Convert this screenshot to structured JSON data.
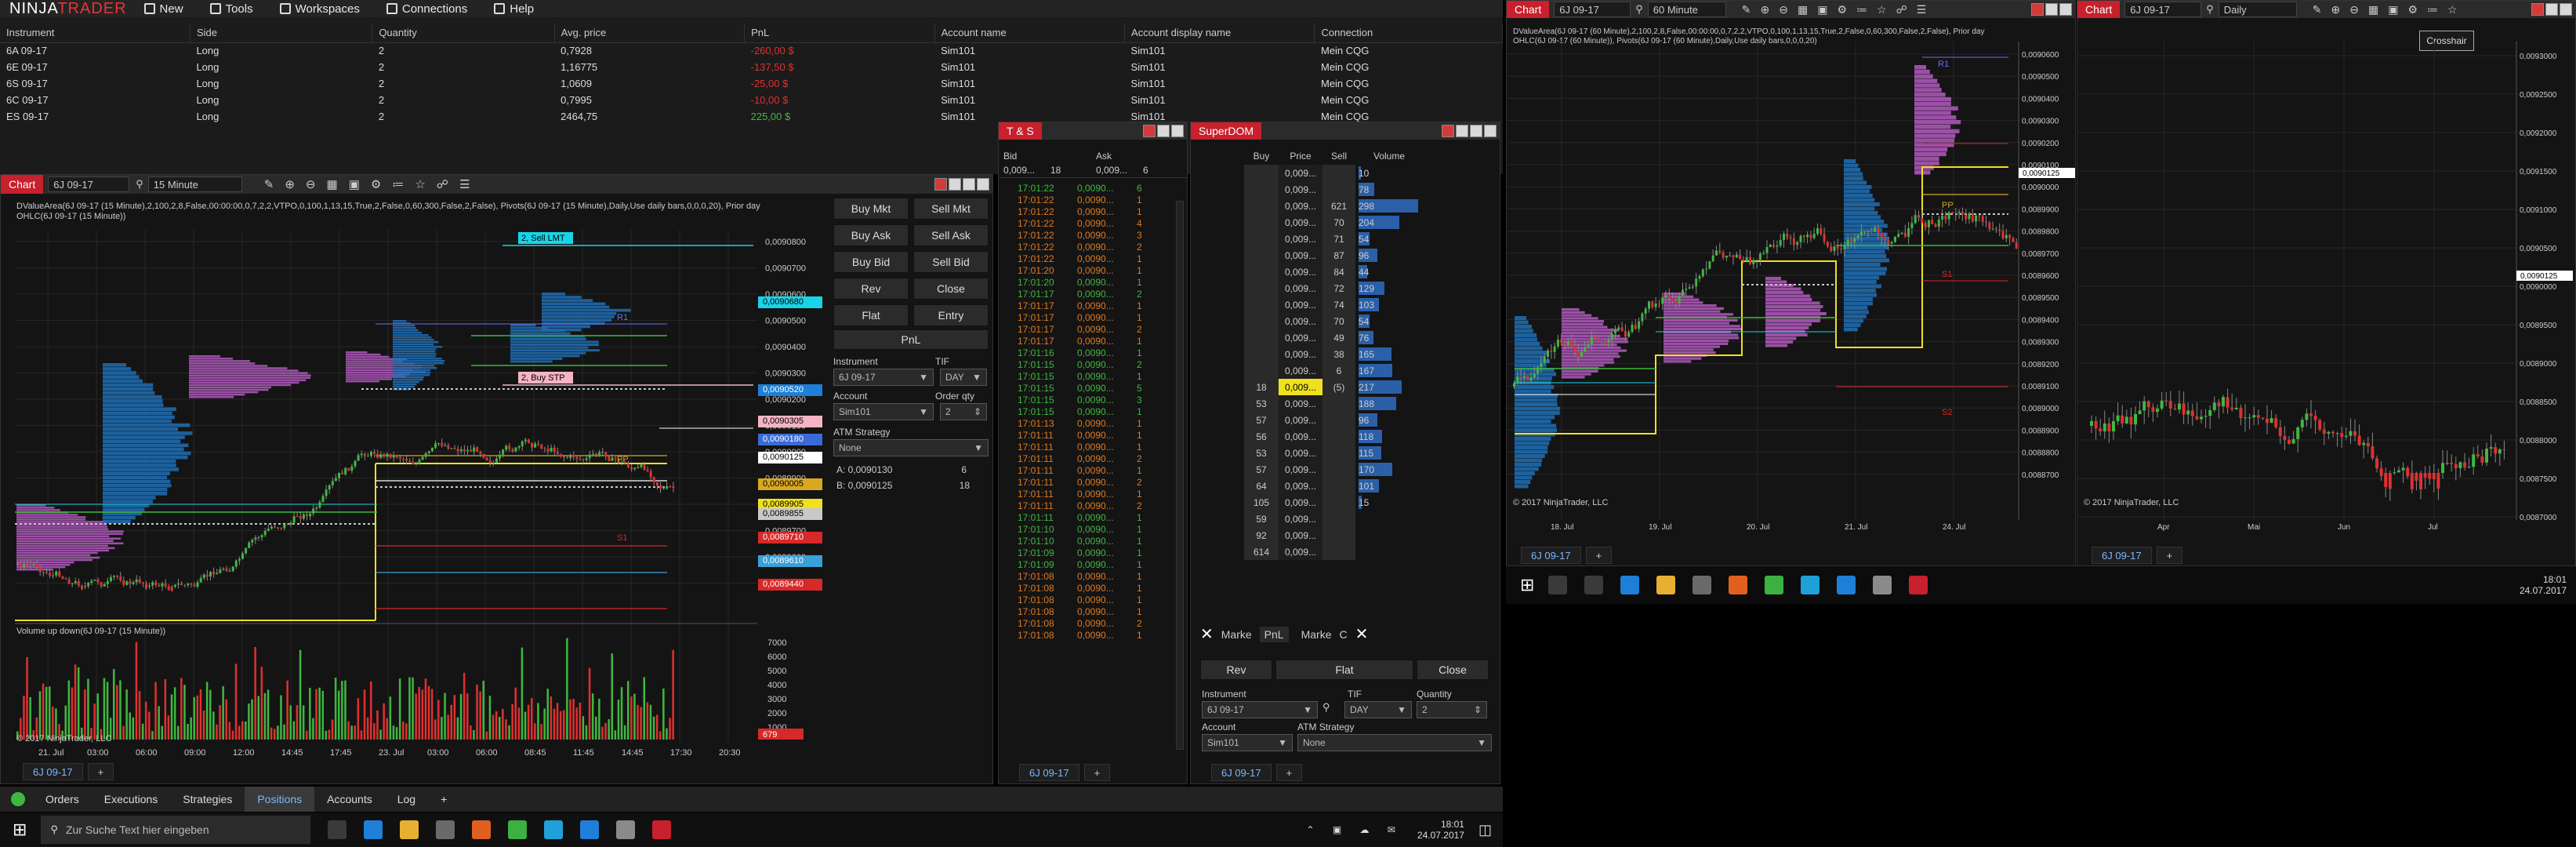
{
  "control_center": {
    "logo_left": "NINJA",
    "logo_right": "TRADER",
    "menu": [
      {
        "label": "New",
        "icon": "file-icon"
      },
      {
        "label": "Tools",
        "icon": "wrench-icon"
      },
      {
        "label": "Workspaces",
        "icon": "monitor-icon"
      },
      {
        "label": "Connections",
        "icon": "plug-icon"
      },
      {
        "label": "Help",
        "icon": "question-icon"
      }
    ],
    "positions": {
      "headers": [
        "Instrument",
        "Side",
        "Quantity",
        "Avg. price",
        "PnL",
        "Account name",
        "Account display name",
        "Connection"
      ],
      "rows": [
        {
          "instrument": "6A 09-17",
          "side": "Long",
          "qty": "2",
          "avg": "0,7928",
          "pnl": "-260,00 $",
          "pnl_sign": "neg",
          "account": "Sim101",
          "display": "Sim101",
          "conn": "Mein CQG"
        },
        {
          "instrument": "6E 09-17",
          "side": "Long",
          "qty": "2",
          "avg": "1,16775",
          "pnl": "-137,50 $",
          "pnl_sign": "neg",
          "account": "Sim101",
          "display": "Sim101",
          "conn": "Mein CQG"
        },
        {
          "instrument": "6S 09-17",
          "side": "Long",
          "qty": "2",
          "avg": "1,0609",
          "pnl": "-25,00 $",
          "pnl_sign": "neg",
          "account": "Sim101",
          "display": "Sim101",
          "conn": "Mein CQG"
        },
        {
          "instrument": "6C 09-17",
          "side": "Long",
          "qty": "2",
          "avg": "0,7995",
          "pnl": "-10,00 $",
          "pnl_sign": "neg",
          "account": "Sim101",
          "display": "Sim101",
          "conn": "Mein CQG"
        },
        {
          "instrument": "ES 09-17",
          "side": "Long",
          "qty": "2",
          "avg": "2464,75",
          "pnl": "225,00 $",
          "pnl_sign": "pos",
          "account": "Sim101",
          "display": "Sim101",
          "conn": "Mein CQG"
        }
      ]
    },
    "bottom_tabs": [
      "Orders",
      "Executions",
      "Strategies",
      "Positions",
      "Accounts",
      "Log"
    ],
    "active_tab": "Positions"
  },
  "chart1": {
    "title": "Chart",
    "instrument": "6J 09-17",
    "interval": "15 Minute",
    "indicator_line1": "DValueArea(6J 09-17 (15 Minute),2,100,2,8,False,00:00:00,0,7,2,2,VTPO,0,100,1,13,15,True,2,False,0,60,300,False,2,False), Pivots(6J 09-17 (15 Minute),Daily,Use daily bars,0,0,0,20), Prior day",
    "indicator_line2": "OHLC(6J 09-17 (15 Minute))",
    "sell_lmt": "2, Sell LMT",
    "buy_stp": "2, Buy STP",
    "pp_label": "PP",
    "s1_label": "S1",
    "r1_label": "R1",
    "volume_label": "Volume up down(6J 09-17 (15 Minute))",
    "copyright": "© 2017 NinjaTrader, LLC",
    "price_ticks": [
      "0,0090800",
      "0,0090700",
      "0,0090600",
      "0,0090500",
      "0,0090400",
      "0,0090300",
      "0,0090200",
      "0,0090100",
      "0,0090000",
      "0,0089900",
      "0,0089800",
      "0,0089700",
      "0,0089600",
      "0,0089500"
    ],
    "price_tags": [
      {
        "label": "0,0090680",
        "color": "#19d4e8",
        "text": "#000"
      },
      {
        "label": "0,0090520",
        "color": "#1e7fd8",
        "text": "#fff"
      },
      {
        "label": "0,0090305",
        "color": "#f4b4c4",
        "text": "#000"
      },
      {
        "label": "0,0090180",
        "color": "#3a6ad8",
        "text": "#fff"
      },
      {
        "label": "0,0090125",
        "color": "#ffffff",
        "text": "#000"
      },
      {
        "label": "0,0090005",
        "color": "#d8a820",
        "text": "#000"
      },
      {
        "label": "0,0089905",
        "color": "#f0e020",
        "text": "#000"
      },
      {
        "label": "0,0089855",
        "color": "#c8c8c8",
        "text": "#000"
      },
      {
        "label": "0,0089710",
        "color": "#d82828",
        "text": "#fff"
      },
      {
        "label": "0,0089610",
        "color": "#3aa0d8",
        "text": "#fff"
      },
      {
        "label": "0,0089440",
        "color": "#d82828",
        "text": "#fff"
      }
    ],
    "time_ticks": [
      "21. Jul",
      "03:00",
      "06:00",
      "09:00",
      "12:00",
      "14:45",
      "17:45",
      "23. Jul",
      "03:00",
      "06:00",
      "08:45",
      "11:45",
      "14:45",
      "17:30",
      "20:30"
    ],
    "volume_ticks": [
      "7000",
      "6000",
      "5000",
      "4000",
      "3000",
      "2000",
      "1000"
    ],
    "volume_tag": "679",
    "tab": "6J 09-17"
  },
  "chart_trader": {
    "buttons": [
      "Buy Mkt",
      "Sell Mkt",
      "Buy Ask",
      "Sell Ask",
      "Buy Bid",
      "Sell Bid",
      "Rev",
      "Close",
      "Flat",
      "Entry"
    ],
    "pnl": "PnL",
    "instrument_label": "Instrument",
    "instrument_value": "6J 09-17",
    "tif_label": "TIF",
    "tif_value": "DAY",
    "account_label": "Account",
    "account_value": "Sim101",
    "order_qty_label": "Order qty",
    "order_qty_value": "2",
    "atm_label": "ATM Strategy",
    "atm_value": "None",
    "ask_line": "A:  0,0090130",
    "ask_qty": "6",
    "bid_line": "B:  0,0090125",
    "bid_qty": "18"
  },
  "ts": {
    "title": "T & S",
    "bid_header": "Bid",
    "ask_header": "Ask",
    "bid_value": "0,009...",
    "bid_size": "18",
    "ask_value": "0,009...",
    "ask_size": "6",
    "rows": [
      {
        "t": "17:01:22",
        "p": "0,0090...",
        "s": "6",
        "c": "g"
      },
      {
        "t": "17:01:22",
        "p": "0,0090...",
        "s": "1",
        "c": "o"
      },
      {
        "t": "17:01:22",
        "p": "0,0090...",
        "s": "1",
        "c": "o"
      },
      {
        "t": "17:01:22",
        "p": "0,0090...",
        "s": "4",
        "c": "o"
      },
      {
        "t": "17:01:22",
        "p": "0,0090...",
        "s": "3",
        "c": "o"
      },
      {
        "t": "17:01:22",
        "p": "0,0090...",
        "s": "2",
        "c": "o"
      },
      {
        "t": "17:01:22",
        "p": "0,0090...",
        "s": "1",
        "c": "o"
      },
      {
        "t": "17:01:20",
        "p": "0,0090...",
        "s": "1",
        "c": "o"
      },
      {
        "t": "17:01:20",
        "p": "0,0090...",
        "s": "1",
        "c": "g"
      },
      {
        "t": "17:01:17",
        "p": "0,0090...",
        "s": "2",
        "c": "g"
      },
      {
        "t": "17:01:17",
        "p": "0,0090...",
        "s": "1",
        "c": "o"
      },
      {
        "t": "17:01:17",
        "p": "0,0090...",
        "s": "1",
        "c": "o"
      },
      {
        "t": "17:01:17",
        "p": "0,0090...",
        "s": "2",
        "c": "o"
      },
      {
        "t": "17:01:17",
        "p": "0,0090...",
        "s": "1",
        "c": "o"
      },
      {
        "t": "17:01:16",
        "p": "0,0090...",
        "s": "1",
        "c": "g"
      },
      {
        "t": "17:01:15",
        "p": "0,0090...",
        "s": "2",
        "c": "g"
      },
      {
        "t": "17:01:15",
        "p": "0,0090...",
        "s": "1",
        "c": "g"
      },
      {
        "t": "17:01:15",
        "p": "0,0090...",
        "s": "5",
        "c": "g"
      },
      {
        "t": "17:01:15",
        "p": "0,0090...",
        "s": "3",
        "c": "g"
      },
      {
        "t": "17:01:15",
        "p": "0,0090...",
        "s": "1",
        "c": "g"
      },
      {
        "t": "17:01:13",
        "p": "0,0090...",
        "s": "1",
        "c": "o"
      },
      {
        "t": "17:01:11",
        "p": "0,0090...",
        "s": "1",
        "c": "o"
      },
      {
        "t": "17:01:11",
        "p": "0,0090...",
        "s": "1",
        "c": "o"
      },
      {
        "t": "17:01:11",
        "p": "0,0090...",
        "s": "2",
        "c": "o"
      },
      {
        "t": "17:01:11",
        "p": "0,0090...",
        "s": "1",
        "c": "o"
      },
      {
        "t": "17:01:11",
        "p": "0,0090...",
        "s": "2",
        "c": "o"
      },
      {
        "t": "17:01:11",
        "p": "0,0090...",
        "s": "1",
        "c": "o"
      },
      {
        "t": "17:01:11",
        "p": "0,0090...",
        "s": "2",
        "c": "o"
      },
      {
        "t": "17:01:11",
        "p": "0,0090...",
        "s": "1",
        "c": "g"
      },
      {
        "t": "17:01:10",
        "p": "0,0090...",
        "s": "1",
        "c": "g"
      },
      {
        "t": "17:01:10",
        "p": "0,0090...",
        "s": "1",
        "c": "g"
      },
      {
        "t": "17:01:09",
        "p": "0,0090...",
        "s": "1",
        "c": "g"
      },
      {
        "t": "17:01:09",
        "p": "0,0090...",
        "s": "1",
        "c": "g"
      },
      {
        "t": "17:01:08",
        "p": "0,0090...",
        "s": "1",
        "c": "o"
      },
      {
        "t": "17:01:08",
        "p": "0,0090...",
        "s": "1",
        "c": "o"
      },
      {
        "t": "17:01:08",
        "p": "0,0090...",
        "s": "1",
        "c": "o"
      },
      {
        "t": "17:01:08",
        "p": "0,0090...",
        "s": "1",
        "c": "o"
      },
      {
        "t": "17:01:08",
        "p": "0,0090...",
        "s": "2",
        "c": "o"
      },
      {
        "t": "17:01:08",
        "p": "0,0090...",
        "s": "1",
        "c": "o"
      }
    ],
    "tab": "6J 09-17"
  },
  "dom": {
    "title": "SuperDOM",
    "headers": [
      "Buy",
      "Price",
      "Sell",
      "Volume"
    ],
    "rows": [
      {
        "buy": "",
        "price": "0,009...",
        "sell": "",
        "vol": "10"
      },
      {
        "buy": "",
        "price": "0,009...",
        "sell": "",
        "vol": "78"
      },
      {
        "buy": "",
        "price": "0,009...",
        "sell": "621",
        "vol": "298"
      },
      {
        "buy": "",
        "price": "0,009...",
        "sell": "70",
        "vol": "204"
      },
      {
        "buy": "",
        "price": "0,009...",
        "sell": "71",
        "vol": "54"
      },
      {
        "buy": "",
        "price": "0,009...",
        "sell": "87",
        "vol": "96"
      },
      {
        "buy": "",
        "price": "0,009...",
        "sell": "84",
        "vol": "44"
      },
      {
        "buy": "",
        "price": "0,009...",
        "sell": "72",
        "vol": "129"
      },
      {
        "buy": "",
        "price": "0,009...",
        "sell": "74",
        "vol": "103"
      },
      {
        "buy": "",
        "price": "0,009...",
        "sell": "70",
        "vol": "54"
      },
      {
        "buy": "",
        "price": "0,009...",
        "sell": "49",
        "vol": "76"
      },
      {
        "buy": "",
        "price": "0,009...",
        "sell": "38",
        "vol": "165"
      },
      {
        "buy": "",
        "price": "0,009...",
        "sell": "6",
        "vol": "167"
      },
      {
        "buy": "18",
        "price": "0,009...",
        "sell": "(5)",
        "vol": "217",
        "current": true
      },
      {
        "buy": "53",
        "price": "0,009...",
        "sell": "",
        "vol": "188"
      },
      {
        "buy": "57",
        "price": "0,009...",
        "sell": "",
        "vol": "96"
      },
      {
        "buy": "56",
        "price": "0,009...",
        "sell": "",
        "vol": "118"
      },
      {
        "buy": "53",
        "price": "0,009...",
        "sell": "",
        "vol": "115"
      },
      {
        "buy": "57",
        "price": "0,009...",
        "sell": "",
        "vol": "170"
      },
      {
        "buy": "64",
        "price": "0,009...",
        "sell": "",
        "vol": "101"
      },
      {
        "buy": "105",
        "price": "0,009...",
        "sell": "",
        "vol": "15"
      },
      {
        "buy": "59",
        "price": "0,009...",
        "sell": "",
        "vol": ""
      },
      {
        "buy": "92",
        "price": "0,009...",
        "sell": "",
        "vol": ""
      },
      {
        "buy": "614",
        "price": "0,009...",
        "sell": "",
        "vol": ""
      }
    ],
    "market_left": "Marke",
    "pnl": "PnL",
    "market_right": "Marke",
    "c_label": "C",
    "rev": "Rev",
    "flat": "Flat",
    "close": "Close",
    "instrument_label": "Instrument",
    "instrument_value": "6J 09-17",
    "tif_label": "TIF",
    "tif_value": "DAY",
    "qty_label": "Quantity",
    "qty_value": "2",
    "account_label": "Account",
    "account_value": "Sim101",
    "atm_label": "ATM Strategy",
    "atm_value": "None",
    "tab": "6J 09-17"
  },
  "chart2": {
    "title": "Chart",
    "instrument": "6J 09-17",
    "interval": "60 Minute",
    "indicator_line1": "DValueArea(6J 09-17 (60 Minute),2,100,2,8,False,00:00:00,0,7,2,2,VTPO,0,100,1,13,15,True,2,False,0,60,300,False,2,False), Prior day",
    "indicator_line2": "OHLC(6J 09-17 (60 Minute)), Pivots(6J 09-17 (60 Minute),Daily,Use daily bars,0,0,0,20)",
    "price_ticks": [
      "0,0090600",
      "0,0090500",
      "0,0090400",
      "0,0090300",
      "0,0090200",
      "0,0090100",
      "0,0090000",
      "0,0089900",
      "0,0089800",
      "0,0089700",
      "0,0089600",
      "0,0089500",
      "0,0089400",
      "0,0089300",
      "0,0089200",
      "0,0089100",
      "0,0089000",
      "0,0088900",
      "0,0088800",
      "0,0088700"
    ],
    "last_tag": "0,0090125",
    "time_ticks": [
      "18. Jul",
      "19. Jul",
      "20. Jul",
      "21. Jul",
      "24. Jul"
    ],
    "r1": "R1",
    "pp": "PP",
    "s1": "S1",
    "s2": "S2",
    "copyright": "© 2017 NinjaTrader, LLC",
    "tab": "6J 09-17"
  },
  "chart3": {
    "title": "Chart",
    "instrument": "6J 09-17",
    "interval": "Daily",
    "crosshair": "Crosshair",
    "price_ticks": [
      "0,0093000",
      "0,0092500",
      "0,0092000",
      "0,0091500",
      "0,0091000",
      "0,0090500",
      "0,0090000",
      "0,0089500",
      "0,0089000",
      "0,0088500",
      "0,0088000",
      "0,0087500",
      "0,0087000"
    ],
    "last_tag": "0,0090125",
    "time_ticks": [
      "Apr",
      "Mai",
      "Jun",
      "Jul"
    ],
    "copyright": "© 2017 NinjaTrader, LLC",
    "tab": "6J 09-17"
  },
  "taskbar_left": {
    "search_placeholder": "Zur Suche Text hier eingeben",
    "time": "18:01",
    "date": "24.07.2017"
  },
  "taskbar_right": {
    "time": "18:01",
    "date": "24.07.2017"
  },
  "colors": {
    "accent_red": "#c8202c",
    "up": "#3fb83f",
    "down": "#e03030",
    "profile_purple": "#b35bbf",
    "profile_blue": "#1f6fb5",
    "tab_blue": "#7ab8ff"
  }
}
